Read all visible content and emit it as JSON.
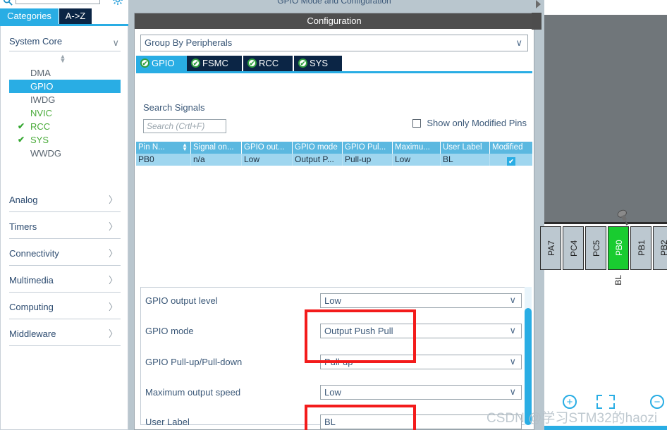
{
  "sidebar": {
    "search_placeholder": "",
    "search_icon": "search-icon",
    "gear_icon": "gear-icon",
    "tabs": [
      {
        "label": "Categories",
        "active": true
      },
      {
        "label": "A->Z",
        "active": false
      }
    ],
    "system_core": {
      "title": "System Core",
      "chevron": "∨",
      "items": [
        {
          "label": "DMA",
          "state": "normal"
        },
        {
          "label": "GPIO",
          "state": "selected"
        },
        {
          "label": "IWDG",
          "state": "normal"
        },
        {
          "label": "NVIC",
          "state": "ok-text"
        },
        {
          "label": "RCC",
          "state": "checked"
        },
        {
          "label": "SYS",
          "state": "checked"
        },
        {
          "label": "WWDG",
          "state": "normal"
        }
      ]
    },
    "groups": [
      {
        "label": "Analog"
      },
      {
        "label": "Timers"
      },
      {
        "label": "Connectivity"
      },
      {
        "label": "Multimedia"
      },
      {
        "label": "Computing"
      },
      {
        "label": "Middleware"
      }
    ],
    "group_chevron": "〉"
  },
  "middle": {
    "mode_title": "GPIO Mode and Configuration",
    "configuration_title": "Configuration",
    "group_by": {
      "value": "Group By Peripherals",
      "chevron": "∨"
    },
    "peripheral_tabs": [
      {
        "label": "GPIO",
        "active": true
      },
      {
        "label": "FSMC",
        "active": false
      },
      {
        "label": "RCC",
        "active": false
      },
      {
        "label": "SYS",
        "active": false
      }
    ],
    "tab_check_glyph": "✔",
    "search_signals_label": "Search Signals",
    "signal_search_placeholder": "Search (Crtl+F)",
    "show_modified_pins": {
      "label": "Show only Modified Pins",
      "checked": false
    },
    "table": {
      "columns": [
        "Pin N...",
        "Signal on...",
        "GPIO out...",
        "GPIO mode",
        "GPIO Pul...",
        "Maximu...",
        "User Label",
        "Modified"
      ],
      "sort_indicator": "↕",
      "rows": [
        {
          "pin_name": "PB0",
          "signal_on": "n/a",
          "gpio_output_level": "Low",
          "gpio_mode": "Output P...",
          "gpio_pull": "Pull-up",
          "maximum_speed": "Low",
          "user_label": "BL",
          "modified": true,
          "modified_glyph": "✔"
        }
      ]
    },
    "form": [
      {
        "label": "GPIO output level",
        "value": "Low",
        "type": "select",
        "highlighted": false
      },
      {
        "label": "GPIO mode",
        "value": "Output Push Pull",
        "type": "select",
        "highlighted": true
      },
      {
        "label": "GPIO Pull-up/Pull-down",
        "value": "Pull-up",
        "type": "select",
        "highlighted": true
      },
      {
        "label": "Maximum output speed",
        "value": "Low",
        "type": "select",
        "highlighted": false
      },
      {
        "label": "User Label",
        "value": "BL",
        "type": "text",
        "highlighted": true
      }
    ],
    "select_chevron": "∨"
  },
  "right_panel": {
    "pins": [
      {
        "label": "PA7",
        "selected": false
      },
      {
        "label": "PC4",
        "selected": false
      },
      {
        "label": "PC5",
        "selected": false
      },
      {
        "label": "PB0",
        "selected": true
      },
      {
        "label": "PB1",
        "selected": false
      },
      {
        "label": "PB2",
        "selected": false
      }
    ],
    "pin_user_label": "BL",
    "zoom_in": "+",
    "zoom_out": "−",
    "fit_icon": "fit-to-screen-icon",
    "pushpin_icon": "pushpin-icon"
  },
  "watermark": "CSDN @学习STM32的haozi",
  "colors": {
    "accent": "#29ade4",
    "tab_dark": "#0b2545",
    "selected_pin": "#19cc30",
    "highlight_box": "#f31b1b",
    "table_header": "#5bb8e0",
    "table_row": "#9fd6ef",
    "chip_body": "#70767a",
    "title_bar": "#4e4e4e"
  }
}
